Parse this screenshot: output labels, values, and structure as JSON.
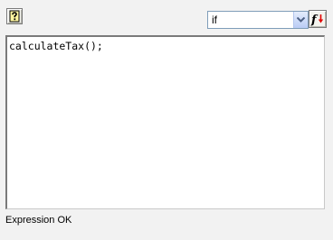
{
  "toolbar": {
    "help_icon": "help-icon",
    "statement_select": {
      "selected": "if"
    },
    "function_icon": "function-icon"
  },
  "editor": {
    "text": "calculateTax();"
  },
  "status": {
    "text": "Expression OK"
  }
}
